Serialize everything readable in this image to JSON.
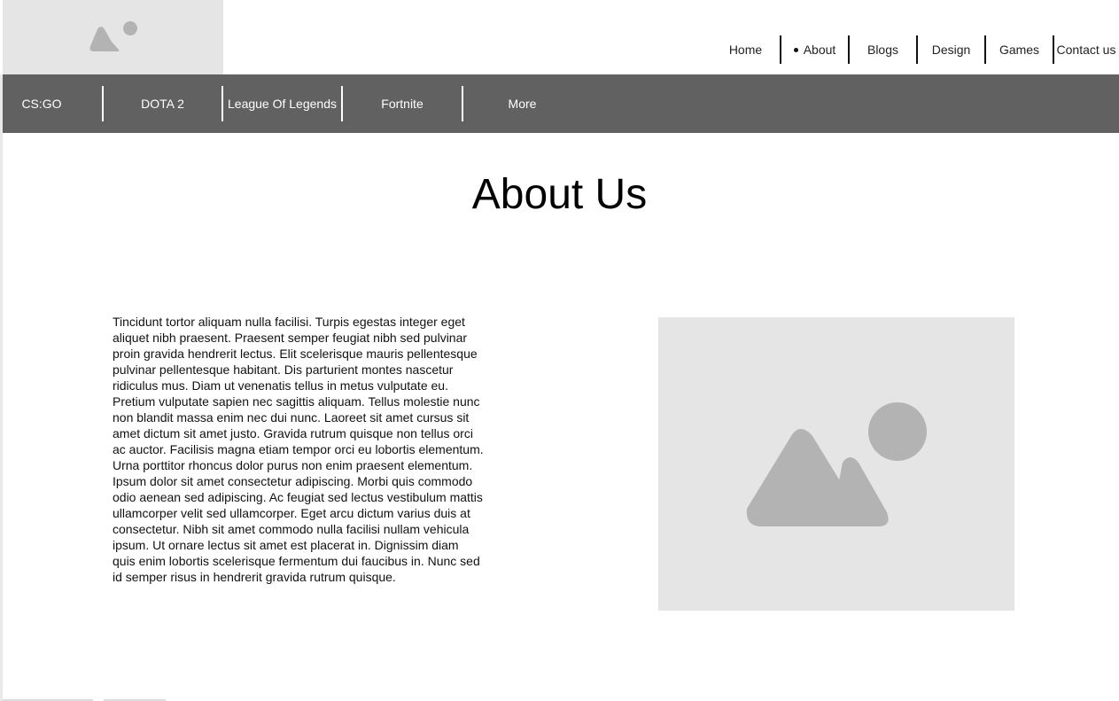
{
  "top_nav": {
    "items": [
      "Home",
      "About",
      "Blogs",
      "Design",
      "Games",
      "Contact us"
    ],
    "active": "About"
  },
  "game_nav": {
    "items": [
      "CS:GO",
      "DOTA 2",
      "League Of Legends",
      "Fortnite",
      "More"
    ]
  },
  "main": {
    "title": "About Us",
    "body": "Tincidunt tortor aliquam nulla facilisi. Turpis egestas integer eget aliquet nibh praesent. Praesent semper feugiat nibh sed pulvinar proin gravida hendrerit lectus. Elit scelerisque mauris pellentesque pulvinar pellentesque habitant. Dis parturient montes nascetur ridiculus mus. Diam ut venenatis tellus in metus vulputate eu. Pretium vulputate sapien nec sagittis aliquam. Tellus molestie nunc non blandit massa enim nec dui nunc. Laoreet sit amet cursus sit amet dictum sit amet justo. Gravida rutrum quisque non tellus orci ac auctor. Facilisis magna etiam tempor orci eu lobortis elementum. Urna porttitor rhoncus dolor purus non enim praesent elementum. Ipsum dolor sit amet consectetur adipiscing. Morbi quis commodo odio aenean sed adipiscing. Ac feugiat sed lectus vestibulum mattis ullamcorper velit sed ullamcorper. Eget arcu dictum varius duis at consectetur. Nibh sit amet commodo nulla facilisi nullam vehicula ipsum. Ut ornare lectus sit amet est placerat in. Dignissim diam quis enim lobortis scelerisque fermentum dui faucibus in. Nunc sed id semper risus in hendrerit gravida rutrum quisque."
  },
  "icons": {
    "logo": "image-placeholder-icon",
    "photo": "image-placeholder-icon"
  },
  "colors": {
    "game_bar_bg": "#616161",
    "placeholder_bg": "#e5e5e5",
    "placeholder_icon": "#b3b3b3"
  }
}
